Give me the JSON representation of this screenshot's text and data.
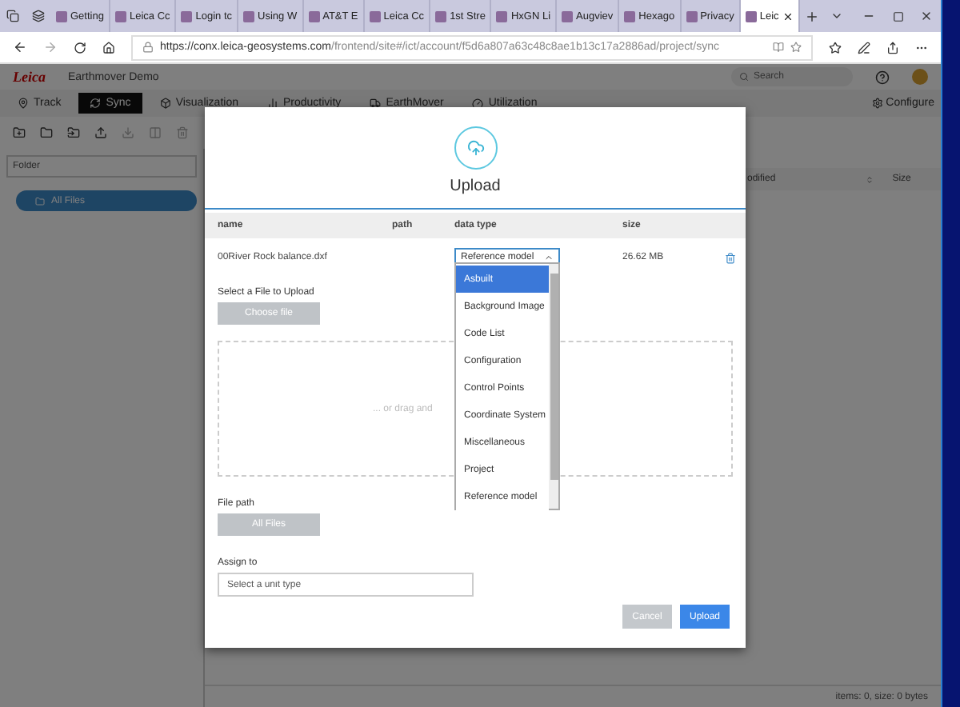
{
  "browser": {
    "tabs": [
      {
        "label": "Getting",
        "selected": false
      },
      {
        "label": "Leica Cc",
        "selected": false
      },
      {
        "label": "Login tc",
        "selected": false
      },
      {
        "label": "Using W",
        "selected": false
      },
      {
        "label": "AT&T E",
        "selected": false
      },
      {
        "label": "Leica Cc",
        "selected": false
      },
      {
        "label": "1st Stre",
        "selected": false
      },
      {
        "label": "HxGN Li",
        "selected": false
      },
      {
        "label": "Augviev",
        "selected": false
      },
      {
        "label": "Hexago",
        "selected": false
      },
      {
        "label": "Privacy",
        "selected": false
      },
      {
        "label": "Leic",
        "selected": true
      }
    ],
    "url_host": "https://conx.leica-geosystems.com",
    "url_path": "/frontend/site#/ict/account/f5d6a807a63c48c8ae1b13c17a2886ad/project/sync"
  },
  "app": {
    "logo": "Leica",
    "project": "Earthmover Demo",
    "search": {
      "placeholder": "Search"
    },
    "nav": [
      {
        "label": "Track",
        "selected": false
      },
      {
        "label": "Sync",
        "selected": true
      },
      {
        "label": "Visualization",
        "selected": false
      },
      {
        "label": "Productivity",
        "selected": false
      },
      {
        "label": "EarthMover",
        "selected": false
      },
      {
        "label": "Utilization",
        "selected": false
      }
    ],
    "configure": "Configure",
    "folder_field": {
      "placeholder": "Folder"
    },
    "folder_item": "All Files",
    "columns": [
      "odified",
      "Size"
    ],
    "status": "items: 0, size: 0 bytes"
  },
  "modal": {
    "title": "Upload",
    "table": {
      "columns": [
        "name",
        "path",
        "data type",
        "size"
      ],
      "row": {
        "name": "00River Rock balance.dxf",
        "data_type": "Reference model",
        "size": "26.62 MB"
      }
    },
    "data_type_options": [
      {
        "label": "Asbuilt",
        "selected": true
      },
      {
        "label": "Background Image",
        "selected": false
      },
      {
        "label": "Code List",
        "selected": false
      },
      {
        "label": "Configuration",
        "selected": false
      },
      {
        "label": "Control Points",
        "selected": false
      },
      {
        "label": "Coordinate System",
        "selected": false
      },
      {
        "label": "Miscellaneous",
        "selected": false
      },
      {
        "label": "Project",
        "selected": false
      },
      {
        "label": "Reference model",
        "selected": false
      }
    ],
    "select_label": "Select a File to Upload",
    "choose_button": "Choose file",
    "drop_hint": "... or drag and",
    "file_path_label": "File path",
    "file_path_button": "All Files",
    "assign_label": "Assign to",
    "assign_field": {
      "placeholder": "Select a unit type"
    },
    "buttons": [
      {
        "label": "Cancel",
        "kind": "secondary"
      },
      {
        "label": "Upload",
        "kind": "primary"
      }
    ]
  }
}
